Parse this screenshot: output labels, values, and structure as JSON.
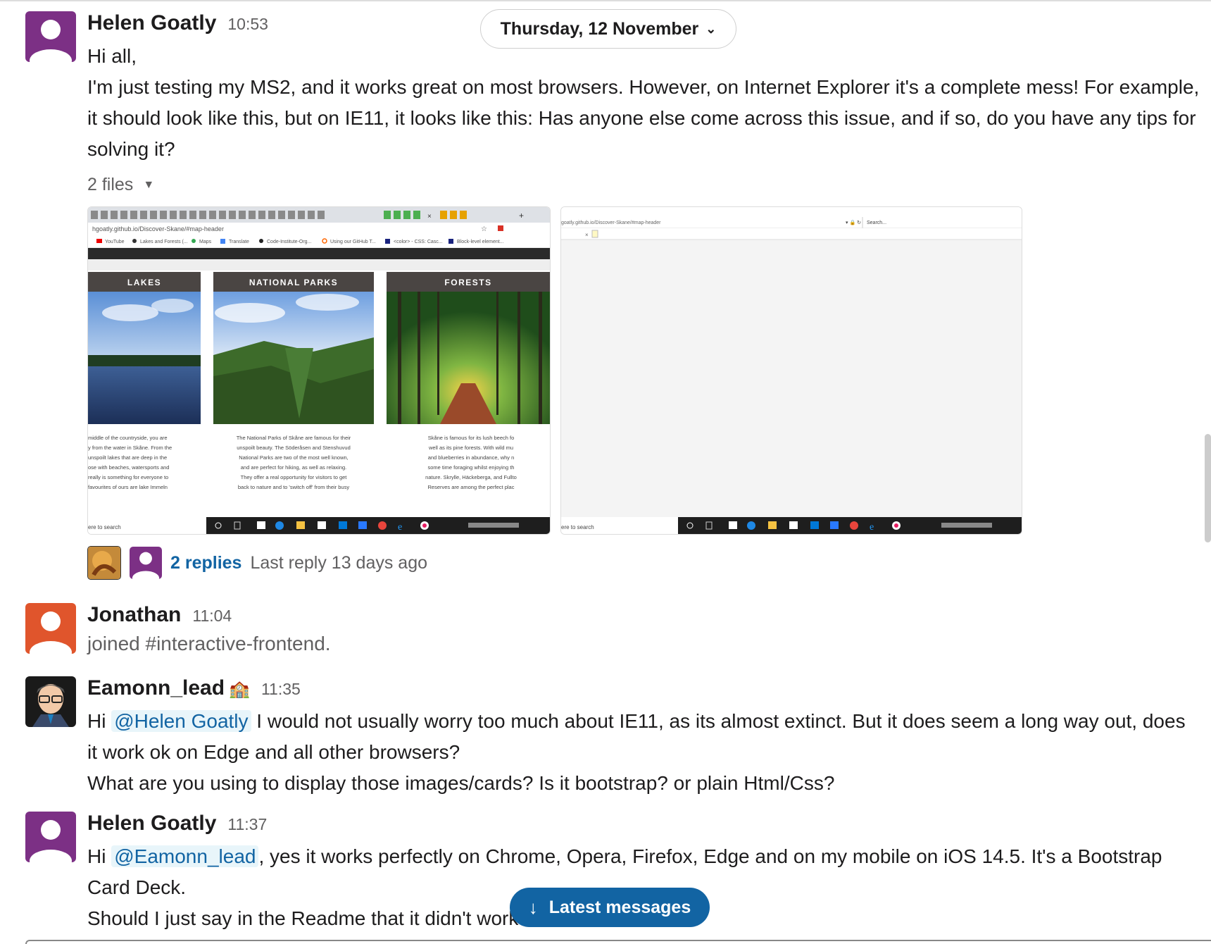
{
  "date_divider": "Thursday, 12 November",
  "messages": [
    {
      "author": "Helen Goatly",
      "time": "10:53",
      "lines": [
        "Hi all,",
        "I'm just testing my MS2, and it works great on most browsers. However, on Internet Explorer it's a complete mess! For example, it should look like this, but on IE11, it looks like this: Has anyone else come across this issue, and if so, do you have any tips for solving it?"
      ],
      "files_label": "2 files",
      "file1": {
        "url": "hgoatly.github.io/Discover-Skane/#map-header",
        "bookmarks": [
          "YouTube",
          "Lakes and Forests (...",
          "Maps",
          "Translate",
          "Code-Institute-Org...",
          "Using our GitHub T...",
          "<color> - CSS: Casc...",
          "Block-level element..."
        ],
        "cards": [
          {
            "title": "LAKES",
            "lines": [
              "middle of the countryside, you are",
              "y from the water in Skåne. From the",
              "unspoilt lakes that are deep in the",
              "ose with beaches, watersports and",
              "really is something for everyone to",
              "favourites of ours are lake Immeln"
            ]
          },
          {
            "title": "NATIONAL PARKS",
            "lines": [
              "The National Parks of Skåne are famous for their",
              "unspoilt beauty. The Söderåsen and Stenshuvud",
              "National Parks are two of the most well known,",
              "and are perfect for hiking, as well as relaxing.",
              "They offer a real opportunity for visitors to get",
              "back to nature and to 'switch off' from their busy"
            ]
          },
          {
            "title": "FORESTS",
            "lines": [
              "Skåne is famous for its lush beech fo",
              "well as its pine forests. With wild mu",
              "and blueberries in abundance, why n",
              "some time foraging whilst enjoying th",
              "nature. Skrylle, Häckeberga, and Fullto",
              "Reserves are among the perfect plac"
            ]
          }
        ],
        "taskbar_search": "ere to search"
      },
      "file2": {
        "url": "goatly.github.io/Discover-Skane/#map-header",
        "search_placeholder": "Search...",
        "taskbar_search": "ere to search"
      },
      "replies_label": "2 replies",
      "last_reply": "Last reply 13 days ago"
    },
    {
      "author": "Jonathan",
      "time": "11:04",
      "text": "joined #interactive-frontend."
    },
    {
      "author": "Eamonn_lead",
      "status_emoji": "🏫",
      "time": "11:35",
      "pre": "Hi ",
      "mention": "@Helen Goatly",
      "post": " I would not usually worry too much about IE11, as its almost extinct. But it does seem a long way out, does it work ok on Edge and all other browsers?",
      "line2": "What are you using to display those images/cards? Is it bootstrap? or plain Html/Css?"
    },
    {
      "author": "Helen Goatly",
      "time": "11:37",
      "pre": "Hi ",
      "mention": "@Eamonn_lead",
      "post": ", yes it works perfectly on Chrome, Opera, Firefox, Edge and on my mobile on iOS 14.5. It's a Bootstrap Card Deck.",
      "line2": "Should I just say in the Readme that it didn't work on IE11?"
    }
  ],
  "latest_button": "Latest messages",
  "colors": {
    "helen_avatar": "#7c3085",
    "jonathan_avatar": "#e0552c",
    "link": "#1264a3"
  }
}
